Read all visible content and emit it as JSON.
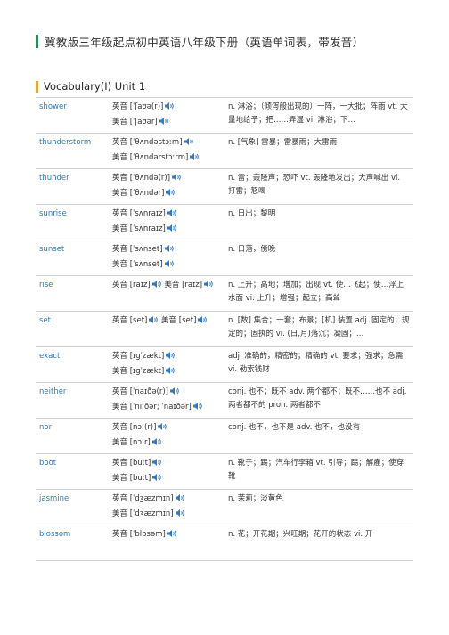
{
  "document": {
    "title": "冀教版三年级起点初中英语八年级下册（英语单词表，带发音）",
    "section_title": "Vocabulary(I) Unit 1",
    "colors": {
      "title_bar": "#2e8b57",
      "section_bar": "#e8a93b",
      "word": "#2f79c8",
      "speaker": "#2f79c8"
    }
  },
  "vocab": [
    {
      "word": "shower",
      "pron": [
        {
          "label": "英音",
          "ipa": "[ˈʃaʊə(r)]"
        },
        {
          "label": "美音",
          "ipa": "[ˈʃaʊər]"
        }
      ],
      "def": "n. 淋浴；（倾泻般出现的）一阵，一大批；阵雨 vt. 大量地给予；把……弄湿 vi. 淋浴；下…"
    },
    {
      "word": "thunderstorm",
      "pron": [
        {
          "label": "英音",
          "ipa": "[ˈθʌndəstɔːm]"
        },
        {
          "label": "美音",
          "ipa": "[ˈθʌndərstɔːrm]"
        }
      ],
      "def": "n. [气象] 雷暴；雷暴雨；大雷雨"
    },
    {
      "word": "thunder",
      "pron": [
        {
          "label": "英音",
          "ipa": "[ˈθʌndə(r)]"
        },
        {
          "label": "美音",
          "ipa": "[ˈθʌndər]"
        }
      ],
      "def": "n. 雷；轰隆声；恐吓 vt. 轰隆地发出；大声喊出 vi. 打雷；怒喝"
    },
    {
      "word": "sunrise",
      "pron": [
        {
          "label": "英音",
          "ipa": "[ˈsʌnraɪz]"
        },
        {
          "label": "美音",
          "ipa": "[ˈsʌnraɪz]"
        }
      ],
      "def": "n. 日出；黎明"
    },
    {
      "word": "sunset",
      "pron": [
        {
          "label": "英音",
          "ipa": "[ˈsʌnset]"
        },
        {
          "label": "美音",
          "ipa": "[ˈsʌnset]"
        }
      ],
      "def": "n. 日落，傍晚"
    },
    {
      "word": "rise",
      "pron_inline": [
        {
          "label": "英音",
          "ipa": "[raɪz]"
        },
        {
          "label": "美音",
          "ipa": "[raɪz]"
        }
      ],
      "def": "n. 上升；高地；增加；出现 vt. 使…飞起；使…浮上水面 vi. 上升；增强；起立；高耸"
    },
    {
      "word": "set",
      "pron_inline": [
        {
          "label": "英音",
          "ipa": "[set]"
        },
        {
          "label": "美音",
          "ipa": "[set]"
        }
      ],
      "def": "n. [数] 集合；一套；布景；[机] 装置 adj. 固定的；规定的；固执的 vi. (日,月)落沉；凝固；…"
    },
    {
      "word": "exact",
      "pron": [
        {
          "label": "英音",
          "ipa": "[ɪɡˈzækt]"
        },
        {
          "label": "美音",
          "ipa": "[ɪɡˈzækt]"
        }
      ],
      "def": "adj. 准确的，精密的；精确的 vt. 要求；强求；急需 vi. 勒索钱财"
    },
    {
      "word": "neither",
      "pron": [
        {
          "label": "英音",
          "ipa": "[ˈnaɪðə(r)]"
        },
        {
          "label": "美音",
          "ipa": "[ˈniːðər; ˈnaɪðər]"
        }
      ],
      "def": "conj. 也不；既不 adv. 两个都不；既不……也不 adj. 两者都不的 pron. 两者都不"
    },
    {
      "word": "nor",
      "pron": [
        {
          "label": "英音",
          "ipa": "[nɔː(r)]"
        },
        {
          "label": "美音",
          "ipa": "[nɔːr]"
        }
      ],
      "def": "conj. 也不，也不是 adv. 也不，也没有"
    },
    {
      "word": "boot",
      "pron": [
        {
          "label": "英音",
          "ipa": "[buːt]"
        },
        {
          "label": "美音",
          "ipa": "[buːt]"
        }
      ],
      "def": "n. 靴子；踢；汽车行李箱 vt. 引导；踢；解雇；使穿靴"
    },
    {
      "word": "jasmine",
      "pron": [
        {
          "label": "英音",
          "ipa": "[ˈdʒæzmɪn]"
        },
        {
          "label": "美音",
          "ipa": "[ˈdʒæzmɪn]"
        }
      ],
      "def": "n. 茉莉；淡黄色"
    },
    {
      "word": "blossom",
      "pron": [
        {
          "label": "英音",
          "ipa": "[ˈblɒsəm]"
        }
      ],
      "def": "n. 花；开花期；兴旺期；花开的状态 vi. 开"
    }
  ]
}
